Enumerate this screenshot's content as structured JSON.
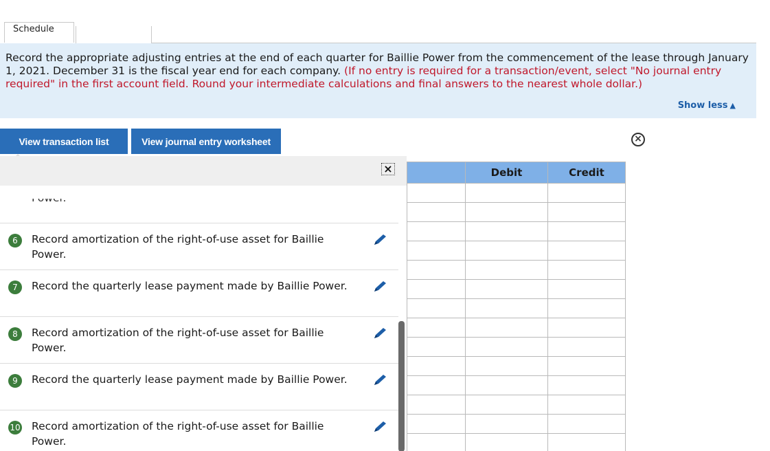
{
  "tabs": {
    "schedule": "Schedule"
  },
  "instructions": {
    "main": "Record the appropriate adjusting  entries at the end of each quarter for Baillie Power from the commencement of the lease through January 1, 2021. December 31 is the fiscal year end for each company.",
    "note": "(If no entry is required for a transaction/event, select \"No journal entry required\" in the first account field. Round your intermediate calculations and final answers to the nearest whole dollar.)",
    "show_less": "Show less"
  },
  "buttons": {
    "view_transaction_list": "View transaction list",
    "view_journal_entry_worksheet": "View journal entry worksheet"
  },
  "transactions": {
    "partial": "Power.",
    "items": [
      {
        "num": "6",
        "text": "Record amortization of the right-of-use asset for Baillie Power."
      },
      {
        "num": "7",
        "text": "Record the quarterly lease payment made by Baillie Power."
      },
      {
        "num": "8",
        "text": "Record amortization of the right-of-use asset for Baillie Power."
      },
      {
        "num": "9",
        "text": "Record the quarterly lease payment made by Baillie Power."
      },
      {
        "num": "10",
        "text": "Record amortization of the right-of-use asset for Baillie Power."
      }
    ]
  },
  "grid": {
    "debit": "Debit",
    "credit": "Credit"
  },
  "icons": {
    "close_circle": "close-circle-icon",
    "close_box": "close-icon",
    "edit": "pencil-icon",
    "show_less_arrow": "triangle-up-icon"
  },
  "colors": {
    "button": "#2a6eb8",
    "panel_bg": "#e1eef9",
    "note_red": "#c0182b",
    "badge_green": "#3c7d3c",
    "grid_header": "#7fb0e7",
    "link": "#1d5ea8"
  }
}
